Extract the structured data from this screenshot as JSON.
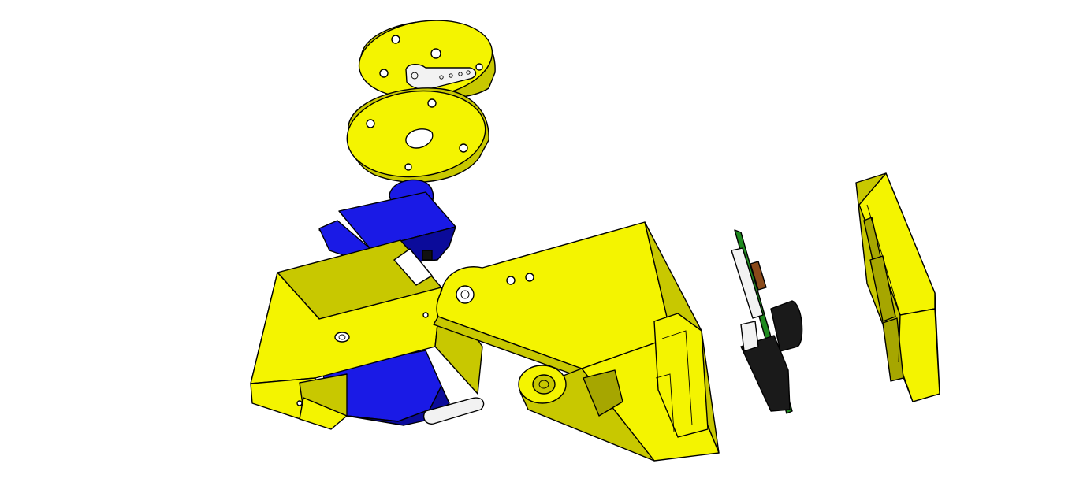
{
  "scene": "exploded-assembly",
  "colors": {
    "yellow": "#f4f400",
    "yellow_shade": "#c8c800",
    "yellow_dark": "#a6a600",
    "servo_blue": "#1a1ae6",
    "servo_blue_dark": "#0b0b9a",
    "pcb_green": "#1f8a1f",
    "lens_black": "#1a1a1a",
    "connector_brown": "#8a4a1a",
    "horn_white": "#f2f2f2",
    "outline": "#000000",
    "background": "#ffffff"
  },
  "parts": [
    {
      "id": "pan-disc-upper",
      "icon": "disc-icon"
    },
    {
      "id": "pan-disc-lower",
      "icon": "disc-icon"
    },
    {
      "id": "servo-horn",
      "icon": "servo-horn-icon"
    },
    {
      "id": "servo-motor",
      "icon": "servo-icon"
    },
    {
      "id": "servo-bracket",
      "icon": "bracket-icon"
    },
    {
      "id": "tilt-arm",
      "icon": "arm-icon"
    },
    {
      "id": "camera-module",
      "icon": "camera-icon"
    },
    {
      "id": "camera-cover",
      "icon": "cover-icon"
    }
  ]
}
